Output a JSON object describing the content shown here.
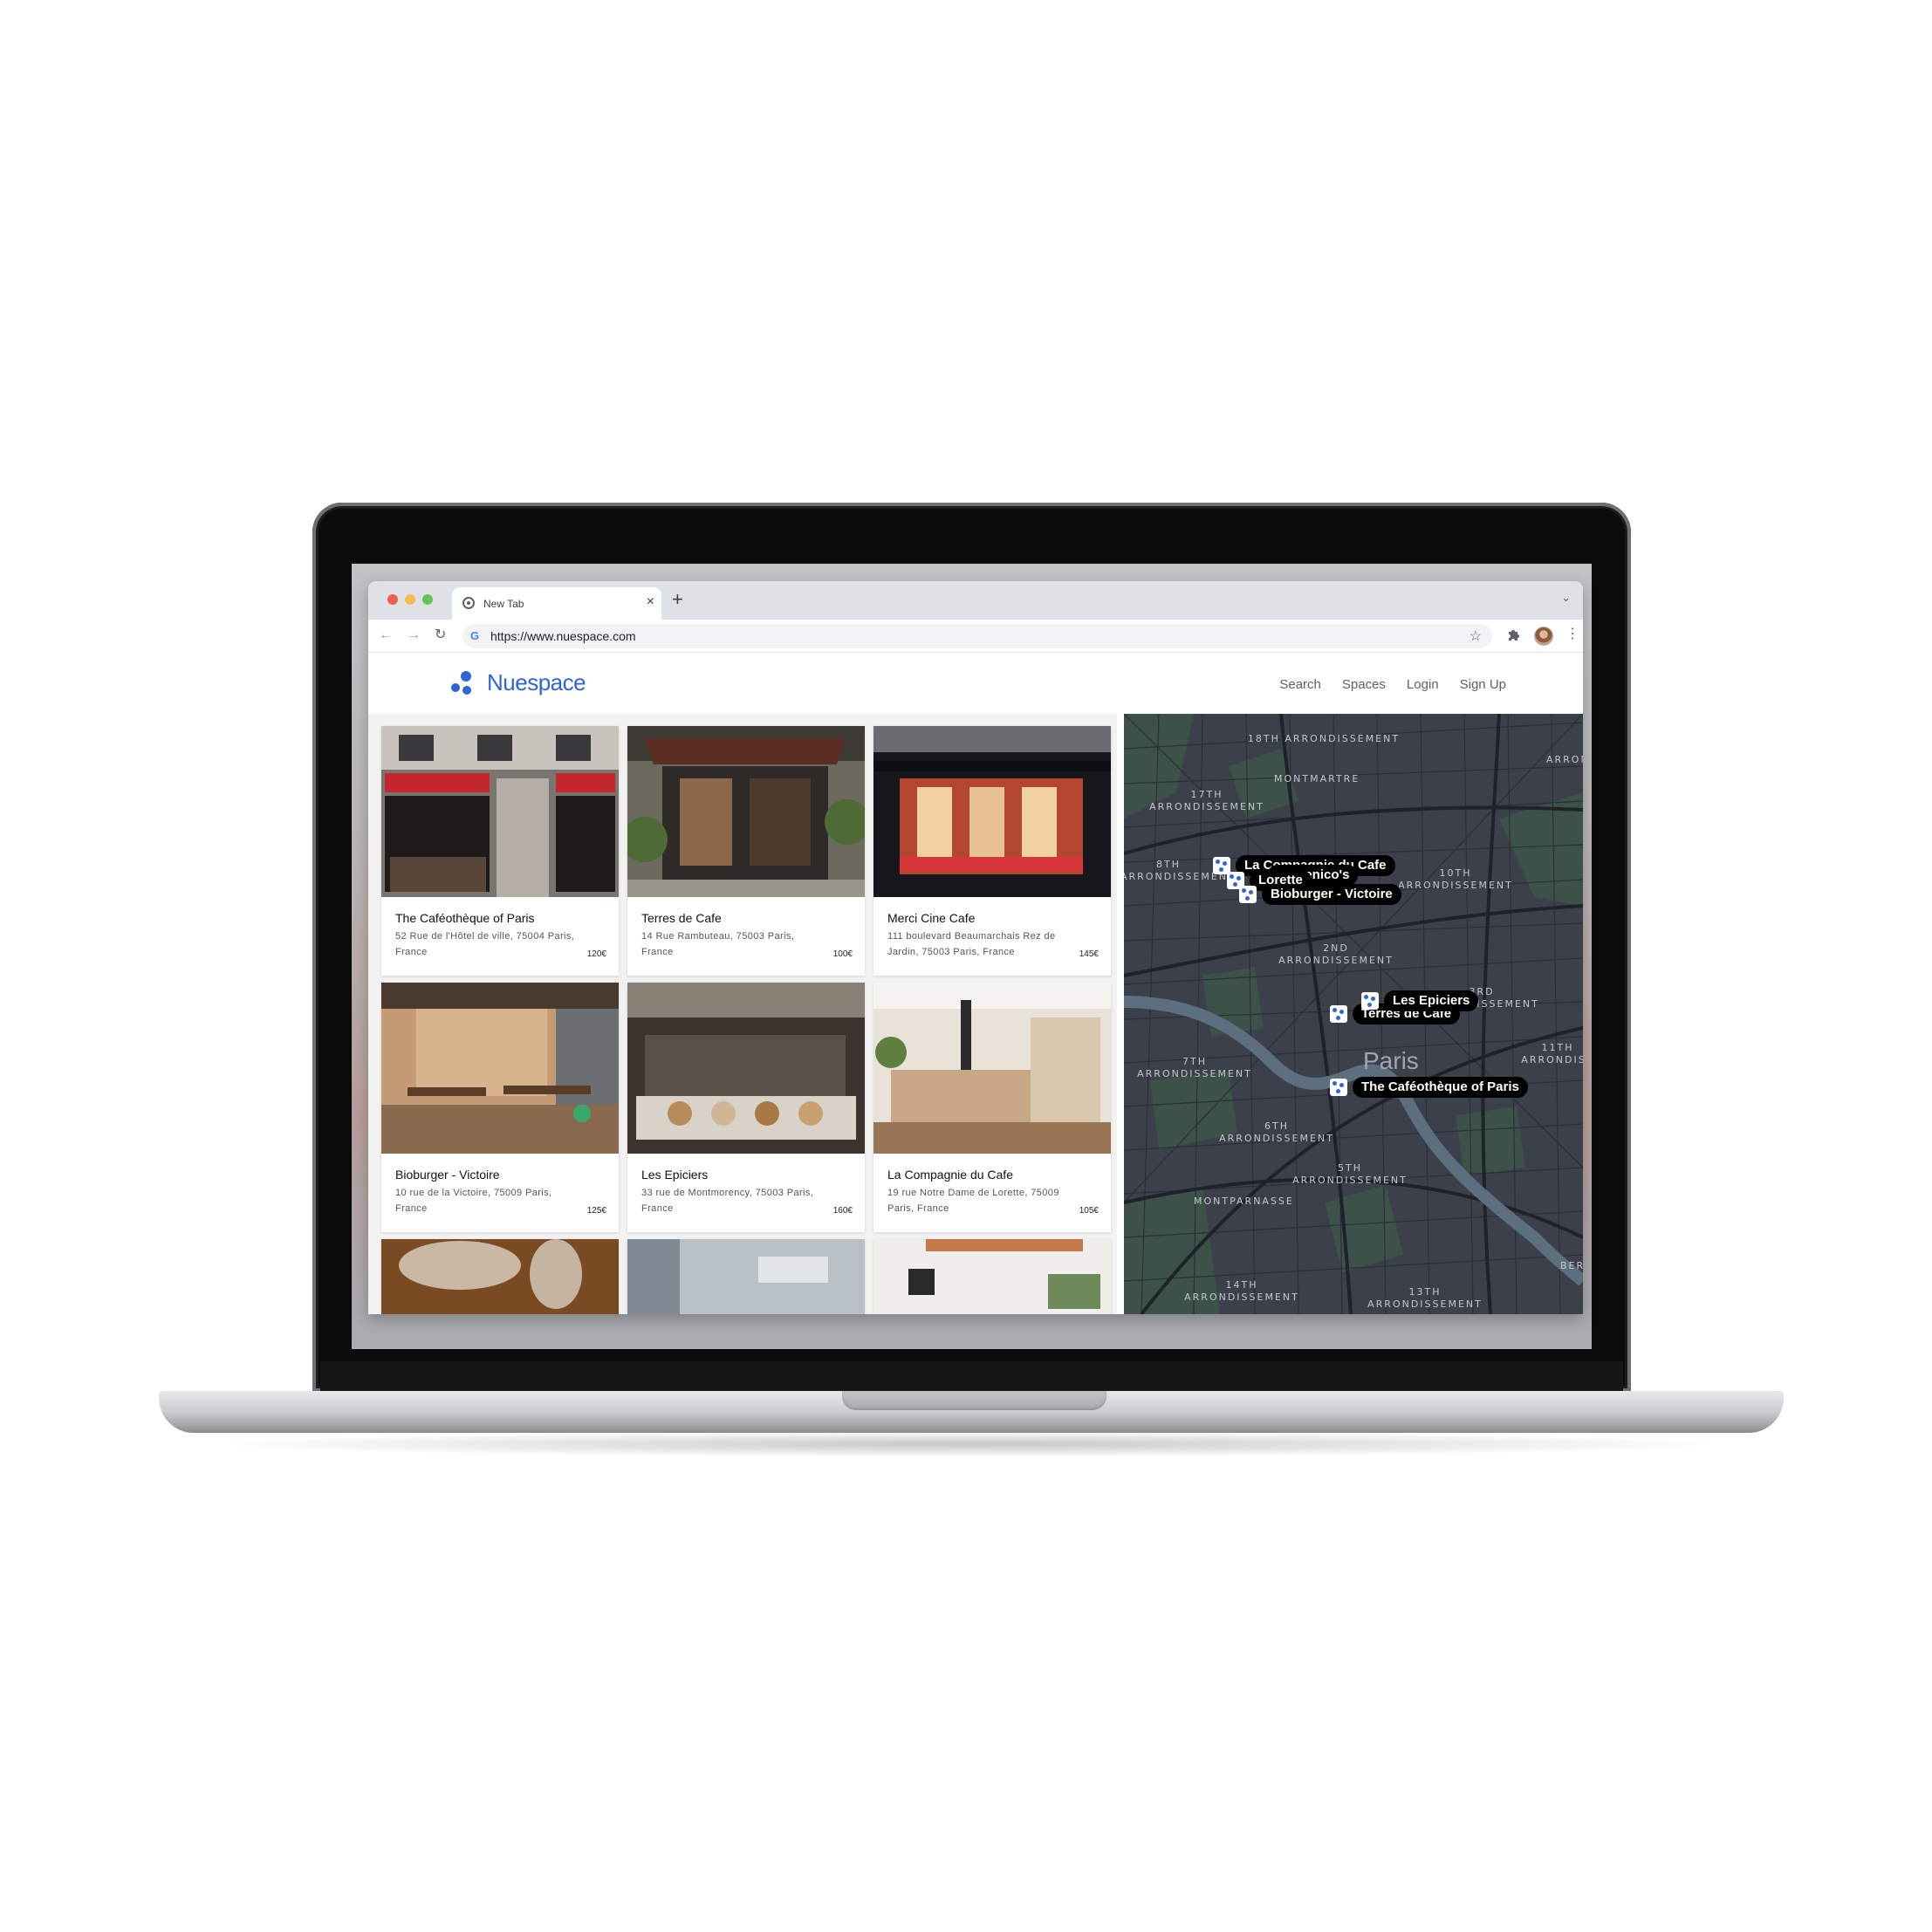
{
  "browser": {
    "tab_title": "New Tab",
    "new_tab": "+",
    "tab_close": "×",
    "url": "https://www.nuespace.com",
    "back": "←",
    "forward": "→",
    "reload": "↻",
    "star": "☆",
    "menu": "⋮",
    "dropdown": "⌄",
    "google_letter": "G"
  },
  "site": {
    "logo_text": "Nuespace",
    "brand_color": "#2f64d6",
    "nav": [
      "Search",
      "Spaces",
      "Login",
      "Sign Up"
    ]
  },
  "listings": [
    {
      "name": "The Caféothèque of Paris",
      "address": "52 Rue de l'Hôtel de ville, 75004 Paris, France",
      "price": "120€"
    },
    {
      "name": "Terres de Cafe",
      "address": "14 Rue Rambuteau, 75003 Paris, France",
      "price": "100€"
    },
    {
      "name": "Merci Cine Cafe",
      "address": "111 boulevard Beaumarchais Rez de Jardin, 75003 Paris, France",
      "price": "145€"
    },
    {
      "name": "Bioburger - Victoire",
      "address": "10 rue de la Victoire, 75009 Paris, France",
      "price": "125€"
    },
    {
      "name": "Les Epiciers",
      "address": "33 rue de Montmorency, 75003 Paris, France",
      "price": "160€"
    },
    {
      "name": "La Compagnie du Cafe",
      "address": "19 rue Notre Dame de Lorette, 75009 Paris, France",
      "price": "105€"
    }
  ],
  "map": {
    "city": "Paris",
    "districts": [
      "18TH ARRONDISSEMENT",
      "MONTMARTRE",
      "17TH ARRONDISSEMENT",
      "8TH ARRONDISSEMENT",
      "10TH ARRONDISSEMENT",
      "2ND ARRONDISSEMENT",
      "3RD ARRONDISSEMENT",
      "7TH ARRONDISSEMENT",
      "11TH ARRONDISS",
      "6TH ARRONDISSEMENT",
      "5TH ARRONDISSEMENT",
      "MONTPARNASSE",
      "14TH ARRONDISSEMENT",
      "13TH ARRONDISSEMENT",
      "ARRON",
      "BER"
    ],
    "pins": [
      "La Compagnie du Cafe",
      "Domenico's",
      "Lorette",
      "Bioburger - Victoire",
      "Les Epiciers",
      "Terres de Cafe",
      "The Caféothèque of Paris"
    ]
  }
}
